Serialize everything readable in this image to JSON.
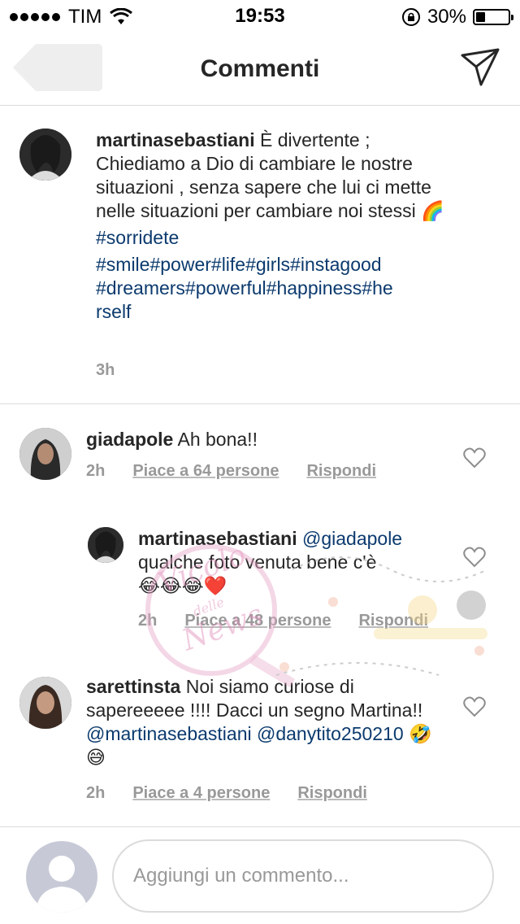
{
  "status_bar": {
    "carrier": "TIM",
    "time": "19:53",
    "battery": "30%",
    "battery_level": 0.3
  },
  "nav": {
    "title": "Commenti",
    "back_icon": "back-arrow-icon",
    "send_icon": "paper-plane-icon"
  },
  "post_caption": {
    "username": "martinasebastiani",
    "text": "È divertente ; Chiediamo a Dio di cambiare le nostre situazioni , senza sapere che lui ci mette nelle situazioni per cambiare noi stessi 🌈",
    "hashtags_line1": "#sorridete",
    "hashtags_line2": "#smile#power#life#girls#instagood",
    "hashtags_line3": "#dreamers#powerful#happiness#he",
    "hashtags_line4": "rself",
    "time": "3h"
  },
  "comments": [
    {
      "username": "giadapole",
      "text": "Ah bona!!",
      "time": "2h",
      "likes": "Piace a 64 persone",
      "reply": "Rispondi"
    },
    {
      "username": "martinasebastiani",
      "mention": "@giadapole",
      "text": "qualche foto venuta bene c'è",
      "emojis": "😂😂😂❤️",
      "time": "2h",
      "likes": "Piace a 48 persone",
      "reply": "Rispondi"
    },
    {
      "username": "sarettinsta",
      "text": "Noi siamo curiose di sapereeeee !!!! Dacci un segno Martina!!",
      "mention1": "@martinasebastiani",
      "mention2": "@danytito250210",
      "emojis": "🤣😅",
      "time": "2h",
      "likes": "Piace a 4 persone",
      "reply": "Rispondi"
    }
  ],
  "composer": {
    "placeholder": "Aggiungi un commento..."
  },
  "watermark": {
    "text1": "Vicolo",
    "text2": "delle",
    "text3": "News"
  },
  "colors": {
    "link_blue": "#0b3a6e",
    "meta_gray": "#999999",
    "divider": "#dbdbdb"
  }
}
